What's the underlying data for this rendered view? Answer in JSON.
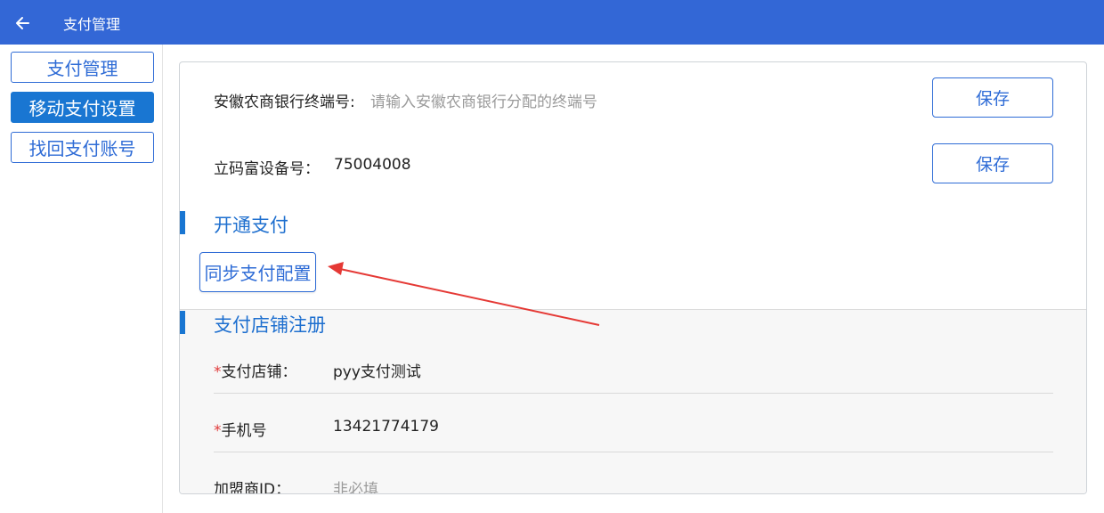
{
  "header": {
    "title": "支付管理",
    "back_icon": "arrow-left-icon"
  },
  "sidebar": {
    "items": [
      {
        "label": "支付管理",
        "active": false
      },
      {
        "label": "移动支付设置",
        "active": true
      },
      {
        "label": "找回支付账号",
        "active": false
      }
    ]
  },
  "bank_terminal": {
    "label": "安徽农商银行终端号:",
    "placeholder": "请输入安徽农商银行分配的终端号",
    "save_label": "保存"
  },
  "device": {
    "label": "立码富设备号：",
    "value": "75004008",
    "save_label": "保存"
  },
  "open_payment": {
    "title": "开通支付",
    "sync_label": "同步支付配置"
  },
  "store_register": {
    "title": "支付店铺注册",
    "fields": [
      {
        "required_mark": "*",
        "label": "支付店铺：",
        "value": "pyy支付测试"
      },
      {
        "required_mark": "*",
        "label": "手机号",
        "value": "13421774179"
      },
      {
        "required_mark": "",
        "label": "加盟商ID：",
        "placeholder": "非必填"
      }
    ]
  },
  "colors": {
    "header_bg": "#3367d6",
    "accent": "#1976d2",
    "required": "#e03a3a",
    "annotation_arrow": "#e53935"
  }
}
